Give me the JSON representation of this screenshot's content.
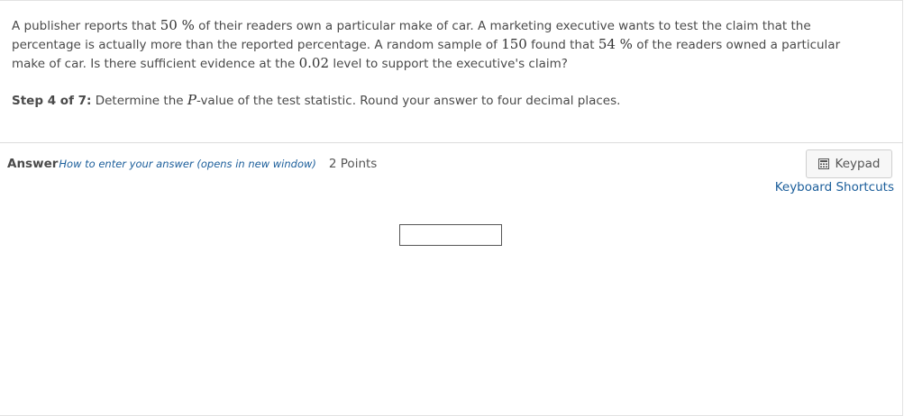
{
  "question": {
    "t1": "A publisher reports that ",
    "m1": "50 %",
    "t2": " of their readers own a particular make of car. A marketing executive wants to test the claim that the percentage is actually more than the reported percentage. A random sample of ",
    "m2": "150",
    "t3": " found that ",
    "m3": "54 %",
    "t4": " of the readers owned a particular make of car. Is there sufficient evidence at the ",
    "m4": "0.02",
    "t5": " level to support the executive's claim?"
  },
  "step": {
    "label": "Step 4 of 7:",
    "t1": " Determine the ",
    "var": "P",
    "t2": "-value of the test statistic. Round your answer to four decimal places."
  },
  "answer": {
    "label": "Answer",
    "help_link": "How to enter your answer (opens in new window)",
    "points": "2 Points",
    "input_value": ""
  },
  "keypad": {
    "label": "Keypad",
    "icon": "calculator-icon"
  },
  "shortcuts": {
    "label": "Keyboard Shortcuts"
  },
  "colors": {
    "link": "#1a5d9a",
    "text": "#4a4a4a",
    "divider": "#dcdcdc"
  }
}
